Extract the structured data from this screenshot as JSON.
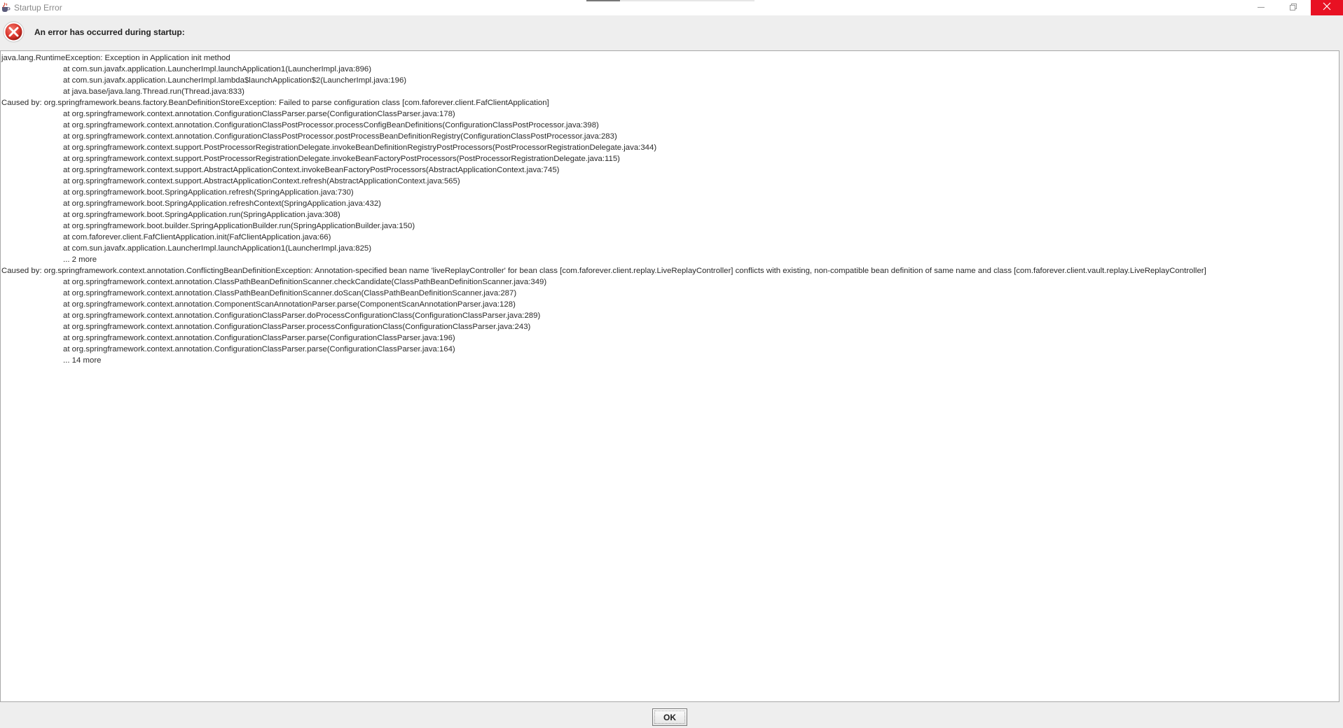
{
  "window": {
    "title": "Startup Error",
    "icons": {
      "app": "java-cup-icon",
      "minimize": "minimize-icon",
      "maximize": "restore-icon",
      "close": "close-icon"
    },
    "colors": {
      "close_button": "#e81123",
      "error_icon": "#d9342b"
    }
  },
  "header": {
    "icon": "error-icon",
    "message": "An error has occurred during startup:"
  },
  "trace": {
    "lines": [
      {
        "text": "java.lang.RuntimeException: Exception in Application init method",
        "indent": false
      },
      {
        "text": "at com.sun.javafx.application.LauncherImpl.launchApplication1(LauncherImpl.java:896)",
        "indent": true
      },
      {
        "text": "at com.sun.javafx.application.LauncherImpl.lambda$launchApplication$2(LauncherImpl.java:196)",
        "indent": true
      },
      {
        "text": "at java.base/java.lang.Thread.run(Thread.java:833)",
        "indent": true
      },
      {
        "text": "Caused by: org.springframework.beans.factory.BeanDefinitionStoreException: Failed to parse configuration class [com.faforever.client.FafClientApplication]",
        "indent": false
      },
      {
        "text": "at org.springframework.context.annotation.ConfigurationClassParser.parse(ConfigurationClassParser.java:178)",
        "indent": true
      },
      {
        "text": "at org.springframework.context.annotation.ConfigurationClassPostProcessor.processConfigBeanDefinitions(ConfigurationClassPostProcessor.java:398)",
        "indent": true
      },
      {
        "text": "at org.springframework.context.annotation.ConfigurationClassPostProcessor.postProcessBeanDefinitionRegistry(ConfigurationClassPostProcessor.java:283)",
        "indent": true
      },
      {
        "text": "at org.springframework.context.support.PostProcessorRegistrationDelegate.invokeBeanDefinitionRegistryPostProcessors(PostProcessorRegistrationDelegate.java:344)",
        "indent": true
      },
      {
        "text": "at org.springframework.context.support.PostProcessorRegistrationDelegate.invokeBeanFactoryPostProcessors(PostProcessorRegistrationDelegate.java:115)",
        "indent": true
      },
      {
        "text": "at org.springframework.context.support.AbstractApplicationContext.invokeBeanFactoryPostProcessors(AbstractApplicationContext.java:745)",
        "indent": true
      },
      {
        "text": "at org.springframework.context.support.AbstractApplicationContext.refresh(AbstractApplicationContext.java:565)",
        "indent": true
      },
      {
        "text": "at org.springframework.boot.SpringApplication.refresh(SpringApplication.java:730)",
        "indent": true
      },
      {
        "text": "at org.springframework.boot.SpringApplication.refreshContext(SpringApplication.java:432)",
        "indent": true
      },
      {
        "text": "at org.springframework.boot.SpringApplication.run(SpringApplication.java:308)",
        "indent": true
      },
      {
        "text": "at org.springframework.boot.builder.SpringApplicationBuilder.run(SpringApplicationBuilder.java:150)",
        "indent": true
      },
      {
        "text": "at com.faforever.client.FafClientApplication.init(FafClientApplication.java:66)",
        "indent": true
      },
      {
        "text": "at com.sun.javafx.application.LauncherImpl.launchApplication1(LauncherImpl.java:825)",
        "indent": true
      },
      {
        "text": "... 2 more",
        "indent": true
      },
      {
        "text": "Caused by: org.springframework.context.annotation.ConflictingBeanDefinitionException: Annotation-specified bean name 'liveReplayController' for bean class [com.faforever.client.replay.LiveReplayController] conflicts with existing, non-compatible bean definition of same name and class [com.faforever.client.vault.replay.LiveReplayController]",
        "indent": false
      },
      {
        "text": "at org.springframework.context.annotation.ClassPathBeanDefinitionScanner.checkCandidate(ClassPathBeanDefinitionScanner.java:349)",
        "indent": true
      },
      {
        "text": "at org.springframework.context.annotation.ClassPathBeanDefinitionScanner.doScan(ClassPathBeanDefinitionScanner.java:287)",
        "indent": true
      },
      {
        "text": "at org.springframework.context.annotation.ComponentScanAnnotationParser.parse(ComponentScanAnnotationParser.java:128)",
        "indent": true
      },
      {
        "text": "at org.springframework.context.annotation.ConfigurationClassParser.doProcessConfigurationClass(ConfigurationClassParser.java:289)",
        "indent": true
      },
      {
        "text": "at org.springframework.context.annotation.ConfigurationClassParser.processConfigurationClass(ConfigurationClassParser.java:243)",
        "indent": true
      },
      {
        "text": "at org.springframework.context.annotation.ConfigurationClassParser.parse(ConfigurationClassParser.java:196)",
        "indent": true
      },
      {
        "text": "at org.springframework.context.annotation.ConfigurationClassParser.parse(ConfigurationClassParser.java:164)",
        "indent": true
      },
      {
        "text": "... 14 more",
        "indent": true
      }
    ]
  },
  "footer": {
    "ok_label": "OK"
  }
}
